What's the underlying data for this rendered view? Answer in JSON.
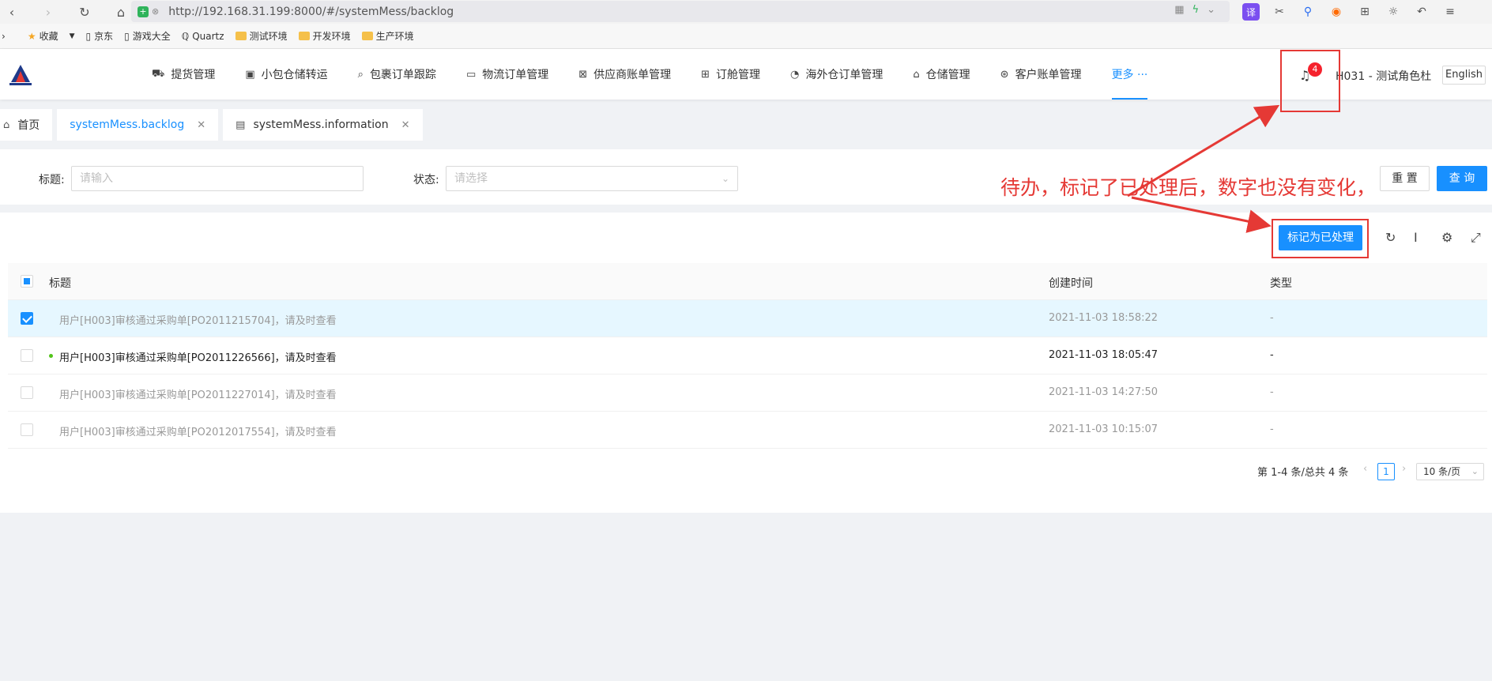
{
  "browser": {
    "url": "http://192.168.31.199:8000/#/systemMess/backlog",
    "ext_translate": "译"
  },
  "bookmarks": [
    "收藏",
    "京东",
    "游戏大全",
    "Quartz",
    "测试环境",
    "开发环境",
    "生产环境"
  ],
  "header": {
    "menu": [
      {
        "label": "提货管理",
        "icon": "truck-icon",
        "glyph": "⛟"
      },
      {
        "label": "小包仓储转运",
        "icon": "box-icon",
        "glyph": "▣"
      },
      {
        "label": "包裹订单跟踪",
        "icon": "search-icon",
        "glyph": "⌕"
      },
      {
        "label": "物流订单管理",
        "icon": "folder-icon",
        "glyph": "▭"
      },
      {
        "label": "供应商账单管理",
        "icon": "bill-icon",
        "glyph": "⊠"
      },
      {
        "label": "订舱管理",
        "icon": "cluster-icon",
        "glyph": "⊞"
      },
      {
        "label": "海外仓订单管理",
        "icon": "dashboard-icon",
        "glyph": "◔"
      },
      {
        "label": "仓储管理",
        "icon": "bank-icon",
        "glyph": "⌂"
      },
      {
        "label": "客户账单管理",
        "icon": "money-icon",
        "glyph": "⊛"
      },
      {
        "label": "更多 ···",
        "icon": "",
        "glyph": ""
      }
    ],
    "notification_count": "4",
    "user": "H031 - 测试角色杜",
    "language": "English"
  },
  "tabs": [
    {
      "label": "首页",
      "icon": "home-icon",
      "glyph": "⌂",
      "closable": false
    },
    {
      "label": "systemMess.backlog",
      "closable": true,
      "active": true
    },
    {
      "label": "systemMess.information",
      "icon": "file-icon",
      "glyph": "▤",
      "closable": true
    }
  ],
  "search": {
    "title_label": "标题:",
    "title_placeholder": "请输入",
    "status_label": "状态:",
    "status_placeholder": "请选择",
    "reset": "重 置",
    "query": "查 询"
  },
  "toolbar": {
    "mark_processed": "标记为已处理"
  },
  "table": {
    "columns": [
      "标题",
      "创建时间",
      "类型"
    ],
    "rows": [
      {
        "title": "用户[H003]审核通过采购单[PO2011215704]，请及时查看",
        "created": "2021-11-03 18:58:22",
        "type": "-",
        "checked": true,
        "unread": false
      },
      {
        "title": "用户[H003]审核通过采购单[PO2011226566]，请及时查看",
        "created": "2021-11-03 18:05:47",
        "type": "-",
        "checked": false,
        "unread": true
      },
      {
        "title": "用户[H003]审核通过采购单[PO2011227014]，请及时查看",
        "created": "2021-11-03 14:27:50",
        "type": "-",
        "checked": false,
        "unread": false
      },
      {
        "title": "用户[H003]审核通过采购单[PO2012017554]，请及时查看",
        "created": "2021-11-03 10:15:07",
        "type": "-",
        "checked": false,
        "unread": false
      }
    ]
  },
  "pagination": {
    "total_text": "第 1-4 条/总共 4 条",
    "current_page": "1",
    "page_size": "10 条/页"
  },
  "annotation": {
    "text": "待办，标记了已处理后，数字也没有变化，",
    "color": "#e53935"
  },
  "colors": {
    "primary": "#1890ff",
    "badge": "#f5222d",
    "unread_dot": "#52c41a"
  }
}
